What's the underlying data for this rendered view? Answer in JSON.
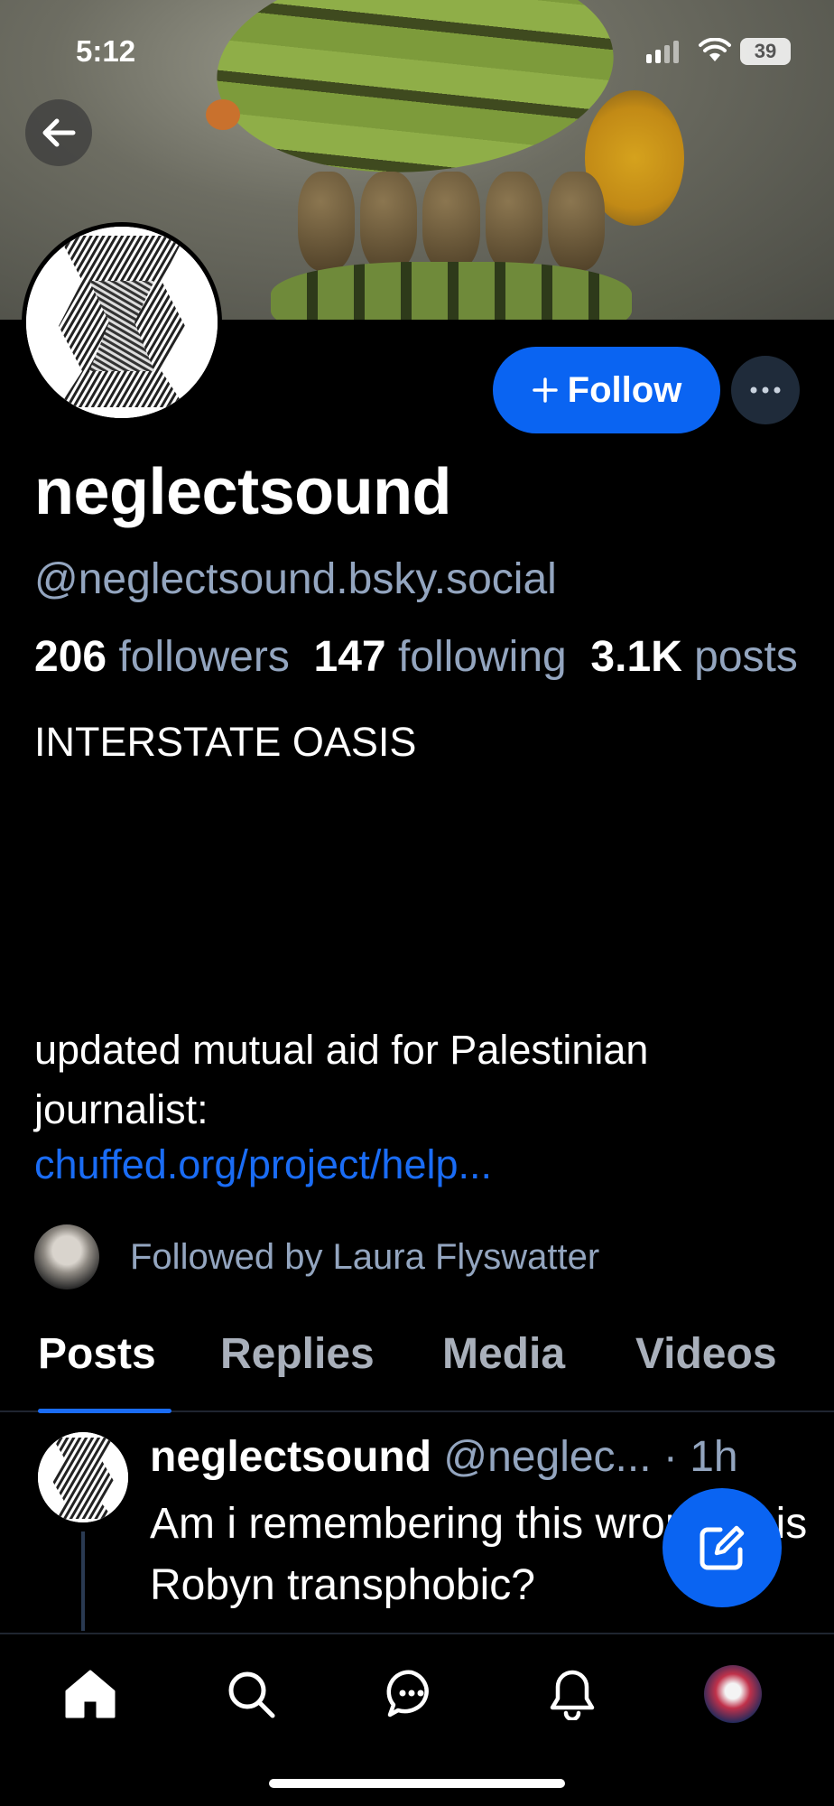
{
  "status_bar": {
    "time": "5:12",
    "battery": "39"
  },
  "profile": {
    "display_name": "neglectsound",
    "handle": "@neglectsound.bsky.social",
    "followers_count": "206",
    "followers_label": "followers",
    "following_count": "147",
    "following_label": "following",
    "posts_count": "3.1K",
    "posts_label": "posts",
    "bio_title": "INTERSTATE OASIS",
    "bio_text": "updated mutual aid for Palestinian journalist:",
    "bio_link": "chuffed.org/project/help...",
    "followed_by": "Followed by Laura Flyswatter"
  },
  "actions": {
    "follow_label": "Follow"
  },
  "tabs": [
    {
      "label": "Posts"
    },
    {
      "label": "Replies"
    },
    {
      "label": "Media"
    },
    {
      "label": "Videos"
    }
  ],
  "post": {
    "author": "neglectsound",
    "handle": "@neglec...",
    "time": "· 1h",
    "text": "Am i remembering this wrong or is Robyn transphobic?"
  },
  "colors": {
    "accent": "#0a64f2",
    "muted": "#93a5bf",
    "background": "#000000"
  },
  "icons": {
    "back": "arrow-left-icon",
    "more": "ellipsis-icon",
    "compose": "compose-icon",
    "nav": [
      "home-icon",
      "search-icon",
      "chat-icon",
      "bell-icon",
      "profile-avatar"
    ]
  }
}
